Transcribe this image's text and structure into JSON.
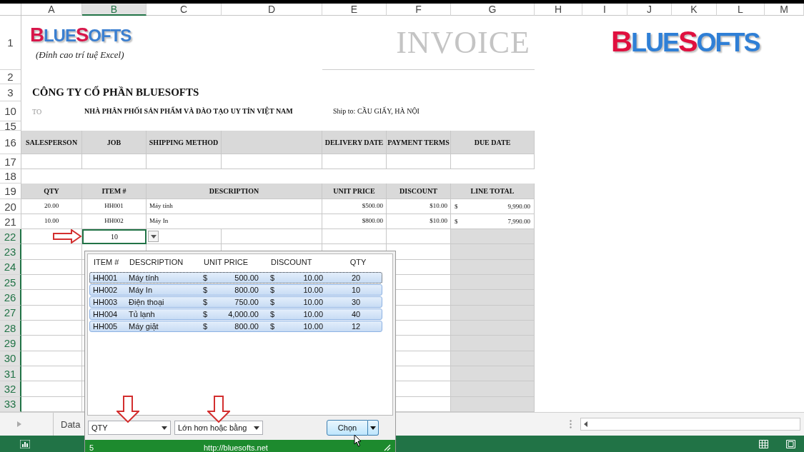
{
  "columns": [
    {
      "label": "A",
      "selected": false
    },
    {
      "label": "B",
      "selected": true
    },
    {
      "label": "C",
      "selected": false
    },
    {
      "label": "D",
      "selected": false
    },
    {
      "label": "E",
      "selected": false
    },
    {
      "label": "F",
      "selected": false
    },
    {
      "label": "G",
      "selected": false
    },
    {
      "label": "H",
      "selected": false
    },
    {
      "label": "I",
      "selected": false
    },
    {
      "label": "J",
      "selected": false
    },
    {
      "label": "K",
      "selected": false
    },
    {
      "label": "L",
      "selected": false
    },
    {
      "label": "M",
      "selected": false
    }
  ],
  "rows": [
    {
      "label": "1",
      "selected": false
    },
    {
      "label": "2",
      "selected": false
    },
    {
      "label": "3",
      "selected": false
    },
    {
      "label": "10",
      "selected": false
    },
    {
      "label": "15",
      "selected": false
    },
    {
      "label": "16",
      "selected": false
    },
    {
      "label": "17",
      "selected": false
    },
    {
      "label": "18",
      "selected": false
    },
    {
      "label": "19",
      "selected": false
    },
    {
      "label": "20",
      "selected": false
    },
    {
      "label": "21",
      "selected": false
    },
    {
      "label": "22",
      "selected": true
    },
    {
      "label": "23",
      "selected": true
    },
    {
      "label": "24",
      "selected": true
    },
    {
      "label": "25",
      "selected": true
    },
    {
      "label": "26",
      "selected": true
    },
    {
      "label": "27",
      "selected": true
    },
    {
      "label": "28",
      "selected": true
    },
    {
      "label": "29",
      "selected": true
    },
    {
      "label": "30",
      "selected": true
    },
    {
      "label": "31",
      "selected": true
    },
    {
      "label": "32",
      "selected": true
    },
    {
      "label": "33",
      "selected": true
    }
  ],
  "logo_small": {
    "parts": [
      {
        "text": "B",
        "color": "#d8164a"
      },
      {
        "text": "LUE",
        "color": "#3b7fd0"
      },
      {
        "text": "S",
        "color": "#d8164a"
      },
      {
        "text": "OFTS",
        "color": "#3b7fd0"
      }
    ],
    "tagline": "(Đỉnh cao trí tuệ Excel)"
  },
  "invoice_title": "INVOICE",
  "logo_large": {
    "parts": [
      {
        "text": "B",
        "color": "#e0103f"
      },
      {
        "text": "LUE",
        "color": "#2f7fd6"
      },
      {
        "text": "S",
        "color": "#e0103f"
      },
      {
        "text": "OFTS",
        "color": "#2f7fd6"
      }
    ]
  },
  "company": "CÔNG TY CỔ PHẦN BLUESOFTS",
  "to_label": "TO",
  "to_value": "NHÀ PHÂN PHỐI SẢN PHẨM VÀ ĐÀO TẠO UY TÍN VIỆT NAM",
  "ship_to": "Ship to: CẦU GIẤY, HÀ NỘI",
  "order_headers": [
    "SALESPERSON",
    "JOB",
    "SHIPPING METHOD",
    "DELIVERY DATE",
    "PAYMENT TERMS",
    "DUE DATE"
  ],
  "line_headers": [
    "QTY",
    "ITEM #",
    "DESCRIPTION",
    "UNIT PRICE",
    "DISCOUNT",
    "LINE TOTAL"
  ],
  "lines": [
    {
      "qty": "20.00",
      "item": "HH001",
      "description": "Máy tính",
      "unit_price": "$500.00",
      "discount": "$10.00",
      "currency": "$",
      "line_total": "9,990.00"
    },
    {
      "qty": "10.00",
      "item": "HH002",
      "description": "Máy In",
      "unit_price": "$800.00",
      "discount": "$10.00",
      "currency": "$",
      "line_total": "7,990.00"
    }
  ],
  "active_cell": {
    "value": "10"
  },
  "popup": {
    "columns": [
      "ITEM #",
      "DESCRIPTION",
      "UNIT PRICE",
      "DISCOUNT",
      "QTY"
    ],
    "rows": [
      {
        "item": "HH001",
        "description": "Máy tính",
        "price_symbol": "$",
        "unit_price": "500.00",
        "discount_symbol": "$",
        "discount": "10.00",
        "qty": "20",
        "selected": true,
        "focused": true
      },
      {
        "item": "HH002",
        "description": "Máy In",
        "price_symbol": "$",
        "unit_price": "800.00",
        "discount_symbol": "$",
        "discount": "10.00",
        "qty": "10",
        "selected": true,
        "focused": false
      },
      {
        "item": "HH003",
        "description": "Điện thoại",
        "price_symbol": "$",
        "unit_price": "750.00",
        "discount_symbol": "$",
        "discount": "10.00",
        "qty": "30",
        "selected": true,
        "focused": false
      },
      {
        "item": "HH004",
        "description": "Tủ lạnh",
        "price_symbol": "$",
        "unit_price": "4,000.00",
        "discount_symbol": "$",
        "discount": "10.00",
        "qty": "40",
        "selected": true,
        "focused": false
      },
      {
        "item": "HH005",
        "description": "Máy giặt",
        "price_symbol": "$",
        "unit_price": "800.00",
        "discount_symbol": "$",
        "discount": "10.00",
        "qty": "12",
        "selected": true,
        "focused": false
      }
    ],
    "field": "QTY",
    "operator": "Lớn hơn hoặc bằng",
    "button": "Chọn",
    "count": "5",
    "url": "http://bluesofts.net"
  },
  "sheet_tabs": [
    {
      "label": "Data",
      "selected": false
    }
  ]
}
